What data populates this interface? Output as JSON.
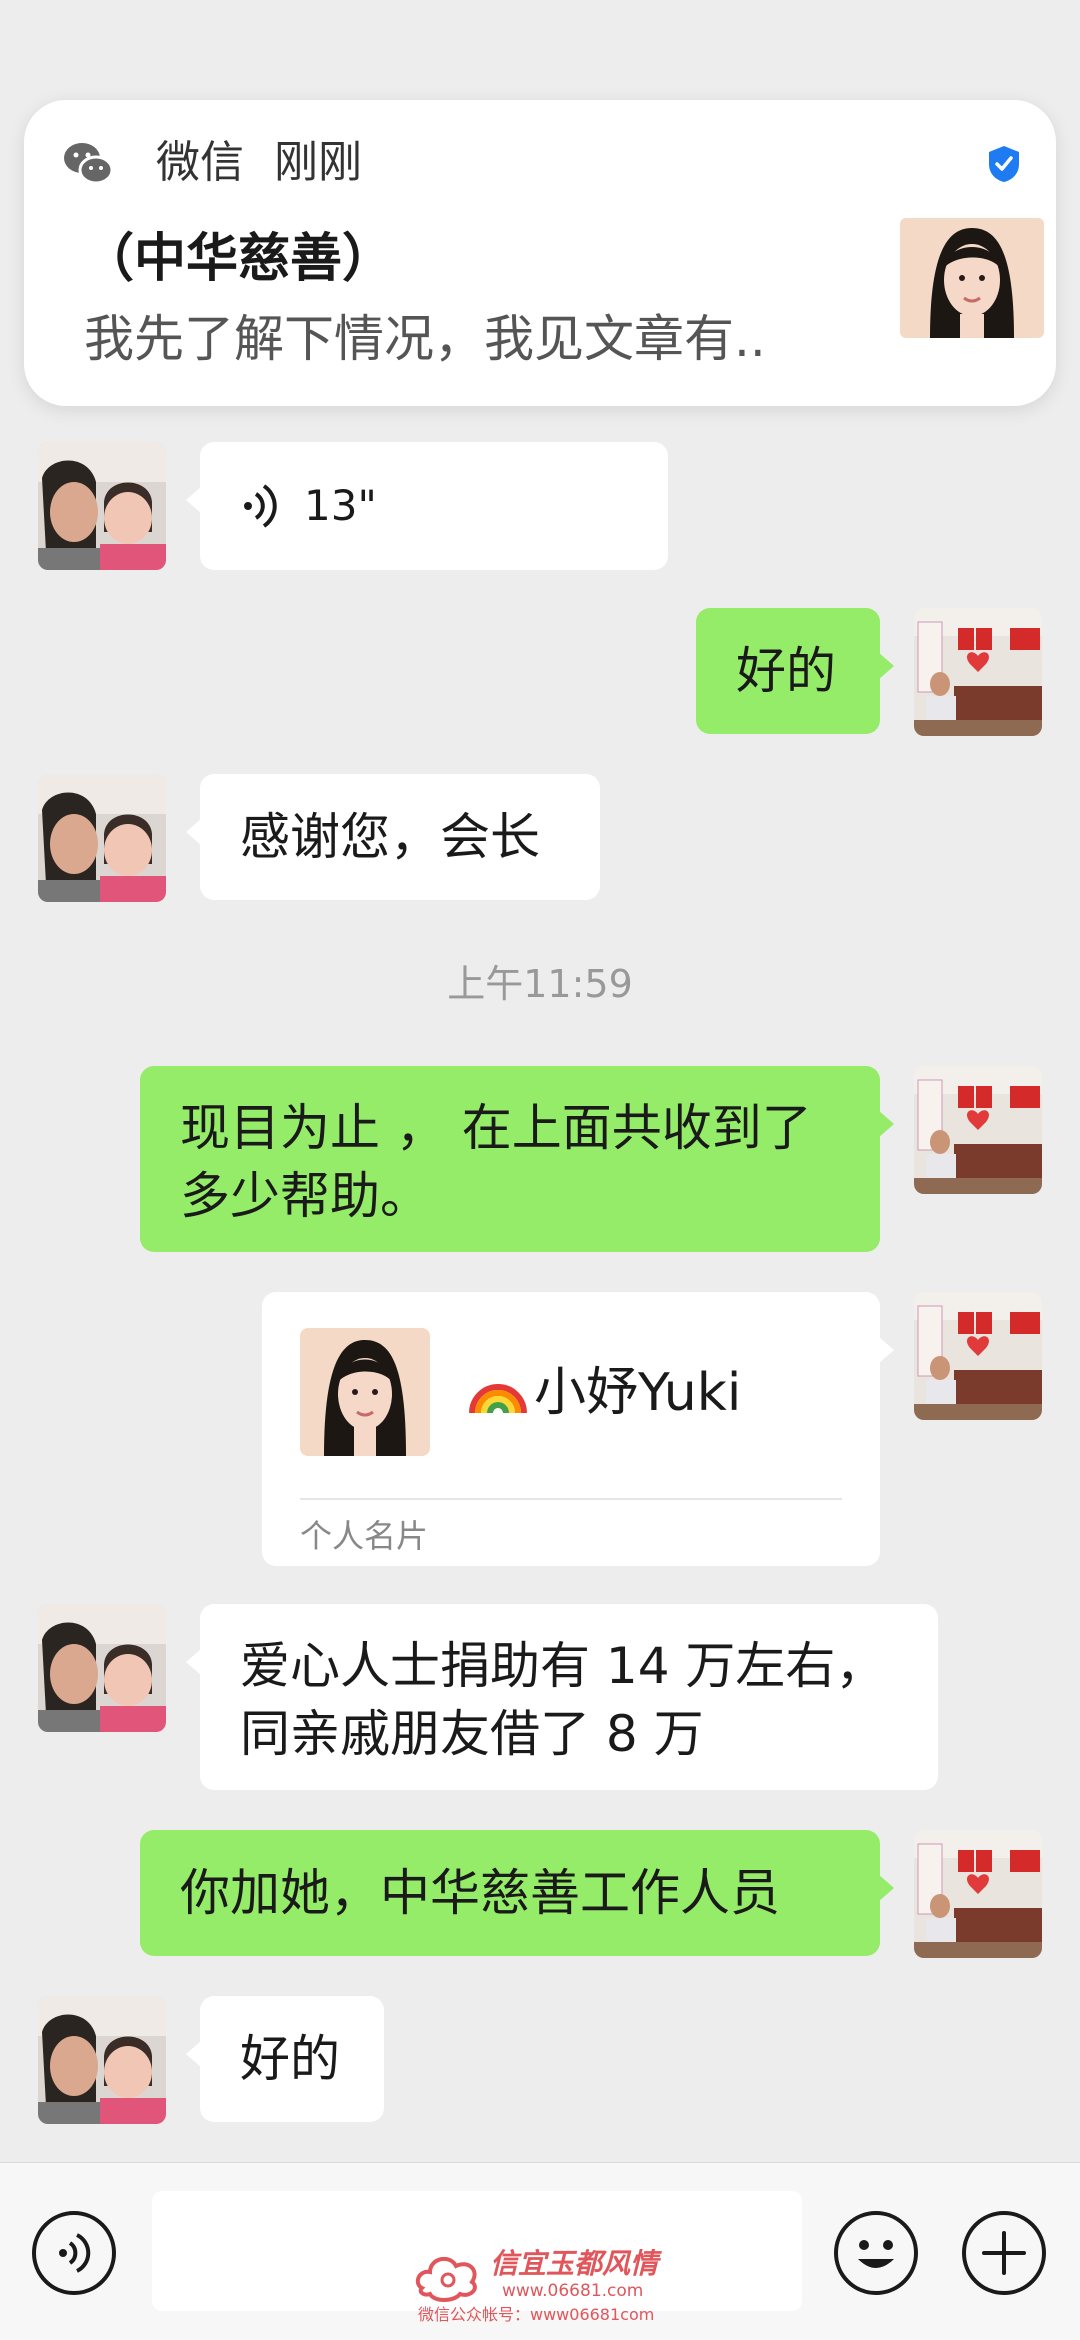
{
  "notification": {
    "app_name": "微信",
    "time": "刚刚",
    "title": "（中华慈善）",
    "body": "我先了解下情况，我见文章有.."
  },
  "messages": [
    {
      "side": "left",
      "type": "voice",
      "text": "13\""
    },
    {
      "side": "right",
      "type": "text",
      "text": "好的"
    },
    {
      "side": "left",
      "type": "text",
      "text": "感谢您，会长"
    },
    {
      "type": "timestamp",
      "text": "上午11:59"
    },
    {
      "side": "right",
      "type": "text",
      "lines": [
        "现目为止 ， 在上面共收到了",
        "多少帮助。"
      ]
    },
    {
      "side": "right",
      "type": "contact_card",
      "name": "小妤Yuki",
      "card_label": "个人名片"
    },
    {
      "side": "left",
      "type": "text",
      "lines": [
        "爱心人士捐助有 14 万左右，",
        "同亲戚朋友借了 8 万"
      ]
    },
    {
      "side": "right",
      "type": "text",
      "text": "你加她，中华慈善工作人员"
    },
    {
      "side": "left",
      "type": "text",
      "text": "好的"
    }
  ],
  "input_bar": {
    "voice_icon": "voice-mode-icon",
    "emoji_icon": "emoji-icon",
    "plus_icon": "plus-icon"
  },
  "watermark": {
    "line1": "信宜玉都风情",
    "line2": "www.06681.com",
    "line3": "微信公众帐号：www06681com"
  },
  "colors": {
    "background": "#EDEDED",
    "sent_bubble": "#95EC69",
    "received_bubble": "#FFFFFF",
    "verified_badge": "#1E7BF2"
  }
}
